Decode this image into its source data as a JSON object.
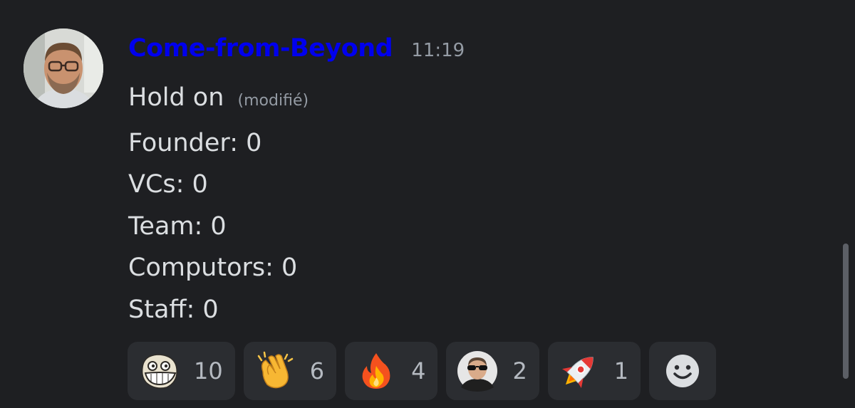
{
  "message": {
    "author": "Come-from-Beyond",
    "author_color": "#0000ee",
    "timestamp": "11:19",
    "first_line": "Hold on",
    "edited_label": "(modifié)",
    "lines": [
      "Founder: 0",
      "VCs: 0",
      "Team: 0",
      "Computors: 0",
      "Staff: 0"
    ]
  },
  "reactions": [
    {
      "icon": "trollface-emoji",
      "count": "10"
    },
    {
      "icon": "clapping-hands-emoji",
      "count": "6"
    },
    {
      "icon": "fire-emoji",
      "count": "4"
    },
    {
      "icon": "sunglasses-avatar-emoji",
      "count": "2"
    },
    {
      "icon": "rocket-emoji",
      "count": "1"
    }
  ],
  "add_reaction_icon": "smiley-add-reaction-icon"
}
